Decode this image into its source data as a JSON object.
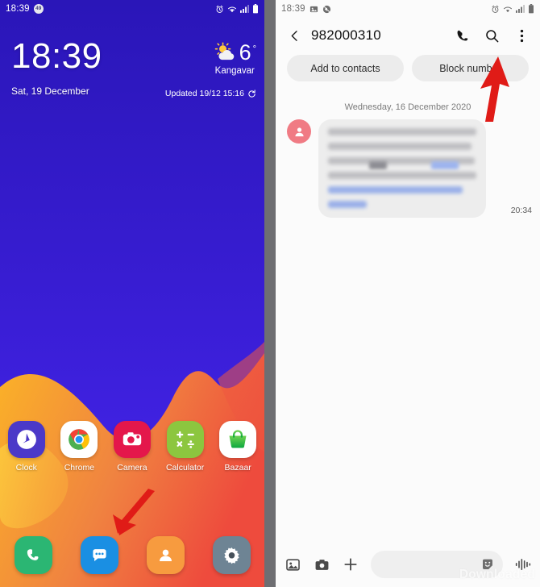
{
  "home": {
    "status_bar": {
      "time": "18:39",
      "badge_label": "49",
      "icons": [
        "alarm-icon",
        "wifi-icon",
        "signal-icon",
        "battery-icon"
      ]
    },
    "clock_widget": {
      "time": "18:39",
      "date": "Sat, 19 December"
    },
    "weather_widget": {
      "temperature": "6",
      "degree_symbol": "°",
      "city": "Kangavar",
      "updated": "Updated 19/12 15:16",
      "condition_icon": "partly-cloudy-icon",
      "refresh_icon": "refresh-icon"
    },
    "apps": [
      {
        "label": "Clock",
        "icon": "clock-app-icon",
        "bg": "#4b39c8"
      },
      {
        "label": "Chrome",
        "icon": "chrome-app-icon",
        "bg": "#ffffff"
      },
      {
        "label": "Camera",
        "icon": "camera-app-icon",
        "bg": "#e4174b"
      },
      {
        "label": "Calculator",
        "icon": "calculator-app-icon",
        "bg": "#8cc63f"
      },
      {
        "label": "Bazaar",
        "icon": "bazaar-app-icon",
        "bg": "#ffffff"
      }
    ],
    "dock": [
      {
        "name": "phone",
        "icon": "phone-app-icon",
        "bg": "#2bb673"
      },
      {
        "name": "messages",
        "icon": "messages-app-icon",
        "bg": "#1a8fe3"
      },
      {
        "name": "contacts",
        "icon": "contacts-app-icon",
        "bg": "#f79b3f"
      },
      {
        "name": "settings",
        "icon": "settings-app-icon",
        "bg": "#6e8494"
      }
    ]
  },
  "thread": {
    "status_bar": {
      "time": "18:39",
      "icons": [
        "image-icon",
        "mute-icon",
        "alarm-icon",
        "wifi-icon",
        "signal-icon",
        "battery-icon"
      ]
    },
    "header": {
      "title": "982000310",
      "back_icon": "back-arrow-icon",
      "call_icon": "phone-icon",
      "search_icon": "search-icon",
      "overflow_icon": "three-dots-menu-icon"
    },
    "actions": {
      "add_to_contacts": "Add to contacts",
      "block_number": "Block number"
    },
    "date_separator": "Wednesday, 16 December 2020",
    "message": {
      "sender_avatar_icon": "person-avatar-icon",
      "body": "",
      "redacted": true,
      "time": "20:34"
    },
    "compose": {
      "gallery_icon": "image-icon",
      "camera_icon": "camera-icon",
      "add_icon": "plus-icon",
      "input_placeholder": "",
      "input_value": "",
      "sticker_icon": "sticker-icon",
      "voice_icon": "voice-waveform-icon"
    }
  },
  "annotations": {
    "arrow_left": "red-arrow-pointing-to-messages-app",
    "arrow_right": "red-arrow-pointing-to-overflow-menu"
  },
  "watermark": {
    "text": "Downloaded"
  },
  "colors": {
    "wallpaper_purple": "#3a1ed6",
    "wallpaper_orange": "#f2963c",
    "wallpaper_yellow": "#fbc02d",
    "wallpaper_red": "#ef5a3c",
    "arrow_red": "#e01b17",
    "avatar_pink": "#f07b84",
    "bubble_gray": "#ededed",
    "chip_gray": "#ececec"
  }
}
